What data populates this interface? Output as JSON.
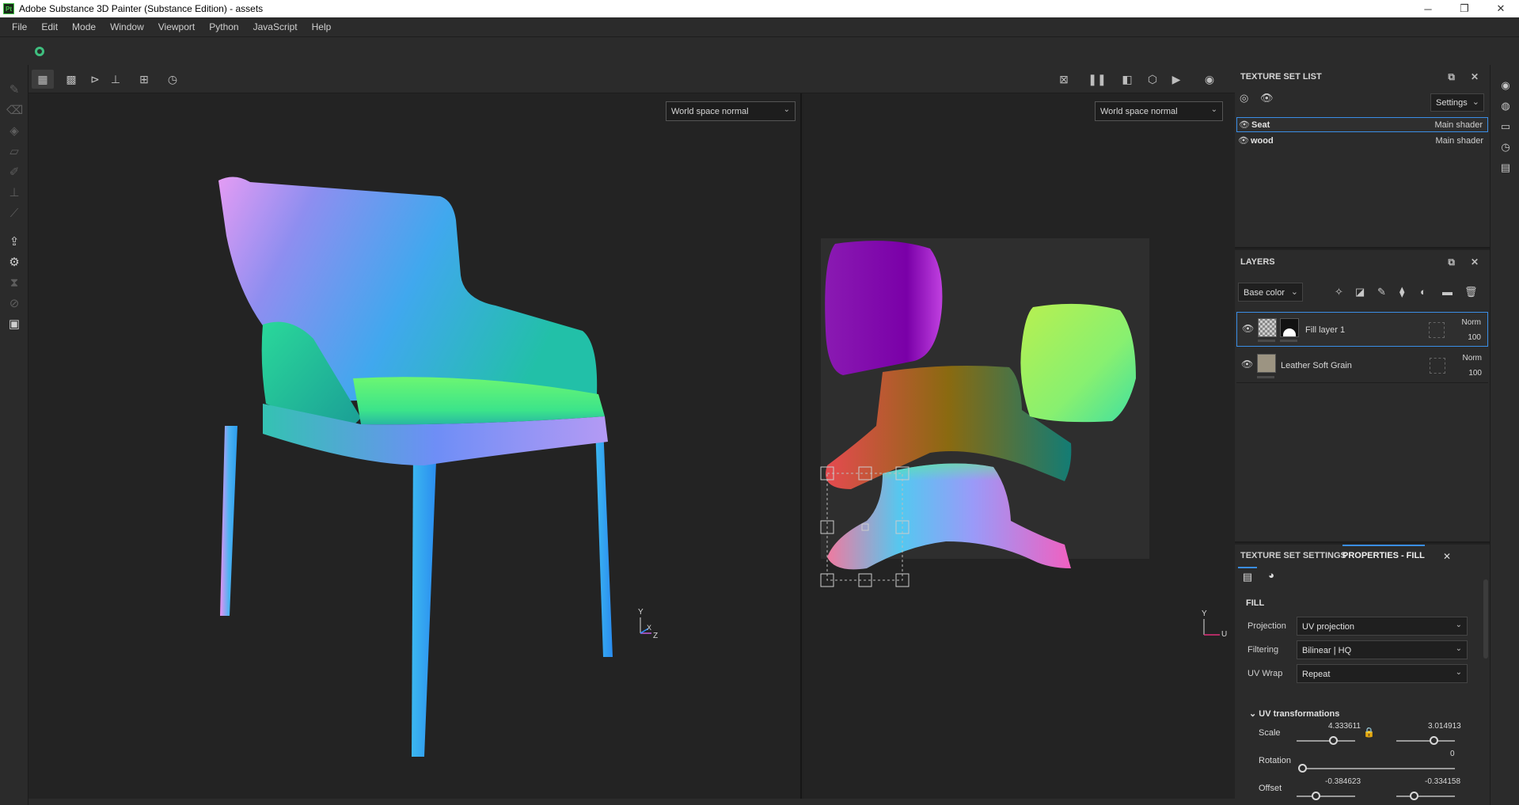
{
  "app": {
    "title": "Adobe Substance 3D Painter (Substance Edition) - assets",
    "logo": "Pt"
  },
  "window_controls": {
    "minimize": "─",
    "restore": "❐",
    "close": "✕"
  },
  "menu": [
    "File",
    "Edit",
    "Mode",
    "Window",
    "Viewport",
    "Python",
    "JavaScript",
    "Help"
  ],
  "viewport": {
    "left_mode": "World space normal",
    "right_mode": "World space normal",
    "axis_left": {
      "y": "Y",
      "x": "X",
      "z": "Z"
    },
    "axis_right": {
      "y": "Y",
      "u": "U"
    }
  },
  "texture_set_list": {
    "title": "TEXTURE SET LIST",
    "settings_label": "Settings",
    "items": [
      {
        "name": "Seat",
        "shader": "Main shader",
        "selected": true
      },
      {
        "name": "wood",
        "shader": "Main shader",
        "selected": false
      }
    ]
  },
  "layers": {
    "title": "LAYERS",
    "channel": "Base color",
    "items": [
      {
        "name": "Fill layer 1",
        "blend": "Norm",
        "opacity": "100",
        "selected": true
      },
      {
        "name": "Leather Soft Grain",
        "blend": "Norm",
        "opacity": "100",
        "selected": false
      }
    ]
  },
  "properties": {
    "tab_texture_set_settings": "TEXTURE SET SETTINGS",
    "tab_properties_fill": "PROPERTIES - FILL",
    "section": "FILL",
    "projection_label": "Projection",
    "projection_value": "UV projection",
    "filtering_label": "Filtering",
    "filtering_value": "Bilinear | HQ",
    "uvwrap_label": "UV Wrap",
    "uvwrap_value": "Repeat",
    "uv_transformations": "UV transformations",
    "scale_label": "Scale",
    "scale_u": "4.333611",
    "scale_v": "3.014913",
    "rotation_label": "Rotation",
    "rotation_value": "0",
    "offset_label": "Offset",
    "offset_u": "-0.384623",
    "offset_v": "-0.334158"
  },
  "colors": {
    "accent": "#3a8ee6",
    "panel_bg": "#2b2b2b",
    "viewport_bg": "#232323"
  }
}
